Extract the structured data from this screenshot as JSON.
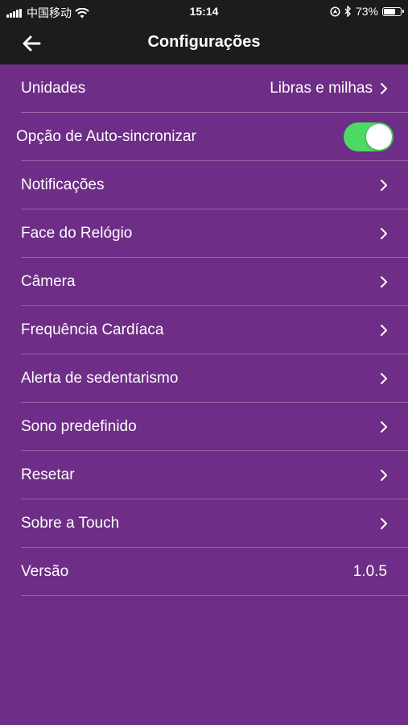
{
  "status_bar": {
    "carrier": "中国移动",
    "time": "15:14",
    "battery_percent": "73%",
    "battery_level": 0.73,
    "icons": [
      "signal-icon",
      "wifi-icon",
      "location-lock-icon",
      "bluetooth-icon",
      "battery-icon"
    ]
  },
  "nav": {
    "title": "Configurações",
    "back_icon": "arrow-left-icon"
  },
  "settings": {
    "units": {
      "label": "Unidades",
      "value": "Libras e milhas"
    },
    "auto_sync": {
      "label": "Opção de Auto-sincronizar",
      "enabled": true
    },
    "notifications": {
      "label": "Notificações"
    },
    "watch_face": {
      "label": "Face do Relógio"
    },
    "camera": {
      "label": "Câmera"
    },
    "heart_rate": {
      "label": "Frequência Cardíaca"
    },
    "sedentary_alert": {
      "label": "Alerta de sedentarismo"
    },
    "default_sleep": {
      "label": "Sono predefinido"
    },
    "reset": {
      "label": "Resetar"
    },
    "about": {
      "label": "Sobre a Touch"
    },
    "version": {
      "label": "Versão",
      "value": "1.0.5"
    }
  },
  "colors": {
    "background": "#6e2d86",
    "bar": "#1c1c1e",
    "toggle_on": "#4cd964"
  }
}
